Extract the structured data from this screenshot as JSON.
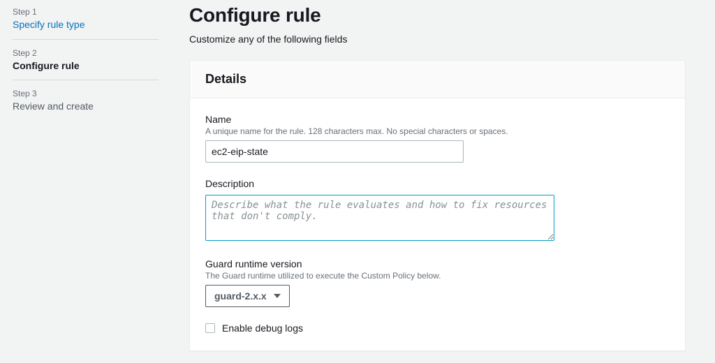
{
  "sidebar": {
    "steps": [
      {
        "number": "Step 1",
        "title": "Specify rule type",
        "state": "link"
      },
      {
        "number": "Step 2",
        "title": "Configure rule",
        "state": "current"
      },
      {
        "number": "Step 3",
        "title": "Review and create",
        "state": "upcoming"
      }
    ]
  },
  "header": {
    "title": "Configure rule",
    "subtitle": "Customize any of the following fields"
  },
  "details": {
    "section_title": "Details",
    "name": {
      "label": "Name",
      "help": "A unique name for the rule. 128 characters max. No special characters or spaces.",
      "value": "ec2-eip-state"
    },
    "description": {
      "label": "Description",
      "placeholder": "Describe what the rule evaluates and how to fix resources that don't comply.",
      "value": ""
    },
    "runtime": {
      "label": "Guard runtime version",
      "help": "The Guard runtime utilized to execute the Custom Policy below.",
      "selected": "guard-2.x.x"
    },
    "debug": {
      "label": "Enable debug logs",
      "checked": false
    }
  }
}
